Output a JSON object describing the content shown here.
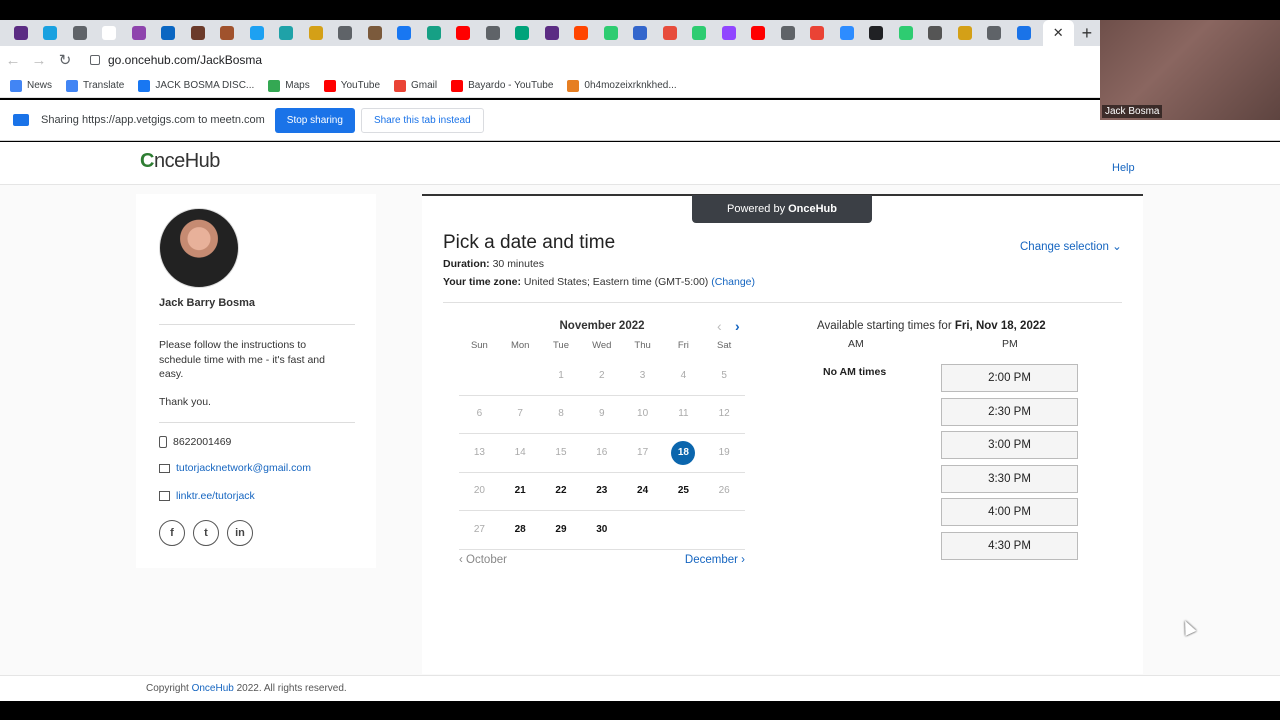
{
  "browser": {
    "tab_favicon_colors": [
      "#5b2c83",
      "#1aa1e0",
      "#5f6368",
      "#ffffff",
      "#8e44ad",
      "#0a66c2",
      "#6b3a2a",
      "#a0522d",
      "#1da1f2",
      "#1fa2a8",
      "#d4a017",
      "#5f6368",
      "#7b5a3c",
      "#1877f2",
      "#16a085",
      "#ff0000",
      "#5f6368",
      "#00a37a",
      "#5b2c83",
      "#ff4500",
      "#2ecc71",
      "#3366cc",
      "#e74c3c",
      "#2ecc71",
      "#9146ff",
      "#ff0000",
      "#5f6368",
      "#ea4335",
      "#2d8cff",
      "#202124",
      "#2ecc71",
      "#555555",
      "#d4a017",
      "#5f6368",
      "#1a73e8"
    ],
    "active_tab_close": "✕",
    "new_tab": "+",
    "url": "go.oncehub.com/JackBosma",
    "bookmarks": [
      {
        "label": "News",
        "color": "#4285f4"
      },
      {
        "label": "Translate",
        "color": "#4285f4"
      },
      {
        "label": "JACK BOSMA DISC...",
        "color": "#1877f2"
      },
      {
        "label": "Maps",
        "color": "#34a853"
      },
      {
        "label": "YouTube",
        "color": "#ff0000"
      },
      {
        "label": "Gmail",
        "color": "#ea4335"
      },
      {
        "label": "Bayardo - YouTube",
        "color": "#ff0000"
      },
      {
        "label": "0h4mozeixrknkhed...",
        "color": "#e67e22"
      }
    ]
  },
  "sharing": {
    "text": "Sharing https://app.vetgigs.com to meetn.com",
    "stop_label": "Stop sharing",
    "share_tab_label": "Share this tab instead"
  },
  "webcam": {
    "name": "Jack Bosma"
  },
  "header": {
    "logo_c": "C",
    "logo_rest": "nceHub",
    "help": "Help"
  },
  "host": {
    "name": "Jack Barry Bosma",
    "instructions": "Please follow the instructions to schedule time with me - it's fast and easy.",
    "thanks": "Thank you.",
    "phone": "8622001469",
    "email": "tutorjacknetwork@gmail.com",
    "link": "linktr.ee/tutorjack",
    "socials": [
      "f",
      "t",
      "in"
    ]
  },
  "booking": {
    "powered_prefix": "Powered by",
    "powered_brand": "OnceHub",
    "title": "Pick a date and time",
    "change_selection": "Change selection",
    "duration_label": "Duration:",
    "duration_value": "30 minutes",
    "tz_label": "Your time zone:",
    "tz_value": "United States;  Eastern time  (GMT-5:00)",
    "tz_change": "(Change)"
  },
  "calendar": {
    "month": "November 2022",
    "weekdays": [
      "Sun",
      "Mon",
      "Tue",
      "Wed",
      "Thu",
      "Fri",
      "Sat"
    ],
    "weeks": [
      [
        "",
        "",
        "1",
        "2",
        "3",
        "4",
        "5"
      ],
      [
        "6",
        "7",
        "8",
        "9",
        "10",
        "11",
        "12"
      ],
      [
        "13",
        "14",
        "15",
        "16",
        "17",
        "18",
        "19"
      ],
      [
        "20",
        "21",
        "22",
        "23",
        "24",
        "25",
        "26"
      ],
      [
        "27",
        "28",
        "29",
        "30",
        "",
        "",
        ""
      ]
    ],
    "available": [
      "21",
      "22",
      "23",
      "24",
      "25",
      "28",
      "29",
      "30"
    ],
    "selected": "18",
    "prev_month": "October",
    "next_month": "December"
  },
  "times": {
    "header_prefix": "Available starting times for",
    "header_date": "Fri, Nov 18, 2022",
    "am_label": "AM",
    "pm_label": "PM",
    "no_am": "No AM times",
    "pm_slots": [
      "2:00 PM",
      "2:30 PM",
      "3:00 PM",
      "3:30 PM",
      "4:00 PM",
      "4:30 PM"
    ]
  },
  "footer": {
    "prefix": "Copyright",
    "brand": "OnceHub",
    "suffix": "2022. All rights reserved."
  }
}
